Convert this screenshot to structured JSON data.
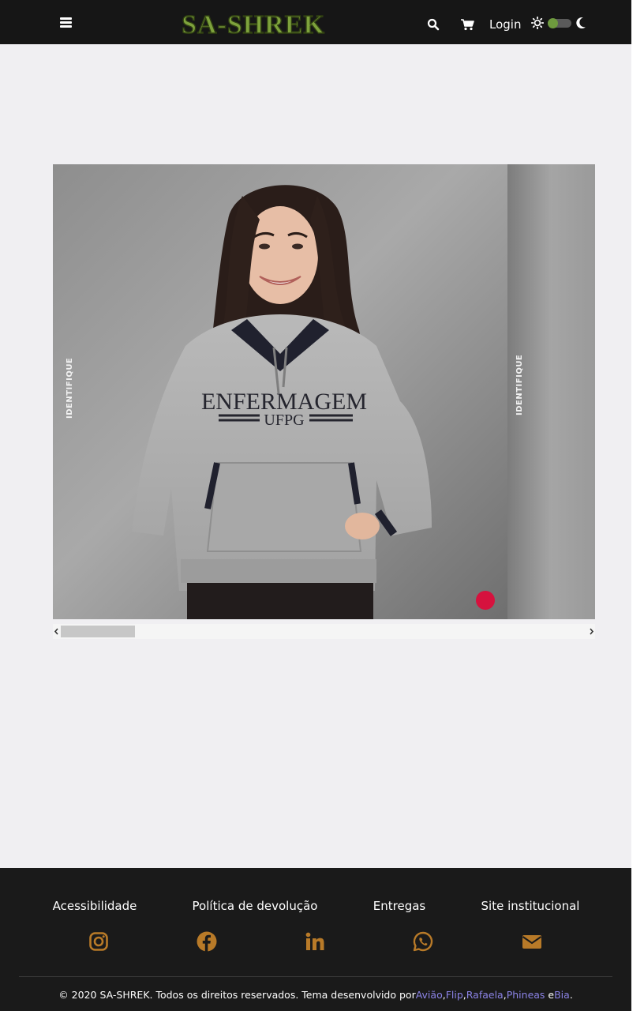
{
  "header": {
    "logo_text": "SA-SHREK",
    "menu_icon": "hamburger-menu-icon",
    "search_icon": "search-icon",
    "cart_icon": "shopping-cart-icon",
    "login_label": "Login",
    "theme": {
      "light_icon": "sun-icon",
      "dark_icon": "moon-icon",
      "toggle_state": "light"
    }
  },
  "carousel": {
    "slides": [
      {
        "shirt_text_line1": "ENFERMAGEM",
        "shirt_text_line2": "UFPG",
        "watermark": "IDENTIFIQUE"
      },
      {
        "watermark": "IDENTIFIQUE"
      }
    ],
    "scroll_left_icon": "chevron-left-icon",
    "scroll_right_icon": "chevron-right-icon"
  },
  "footer": {
    "links": [
      {
        "label": "Acessibilidade"
      },
      {
        "label": "Política de devolução"
      },
      {
        "label": "Entregas"
      },
      {
        "label": "Site institucional"
      }
    ],
    "social": [
      {
        "icon": "instagram-icon"
      },
      {
        "icon": "facebook-icon"
      },
      {
        "icon": "linkedin-icon"
      },
      {
        "icon": "whatsapp-icon"
      },
      {
        "icon": "envelope-icon"
      }
    ],
    "social_color": "#b87a28",
    "copyright_text": "© 2020 SA-SHREK. Todos os direitos reservados. Tema desenvolvido por",
    "credits": [
      "Avião",
      "Flip",
      "Rafaela",
      "Phineas",
      "Bia"
    ],
    "credit_sep": ",",
    "credit_and": " e",
    "credit_end": "."
  },
  "colors": {
    "topbar": "#161616",
    "page_bg": "#f0eff2",
    "footer_bg": "#1a1a1a",
    "logo_green": "#7ea23c",
    "credit_link": "#8b83e6"
  }
}
